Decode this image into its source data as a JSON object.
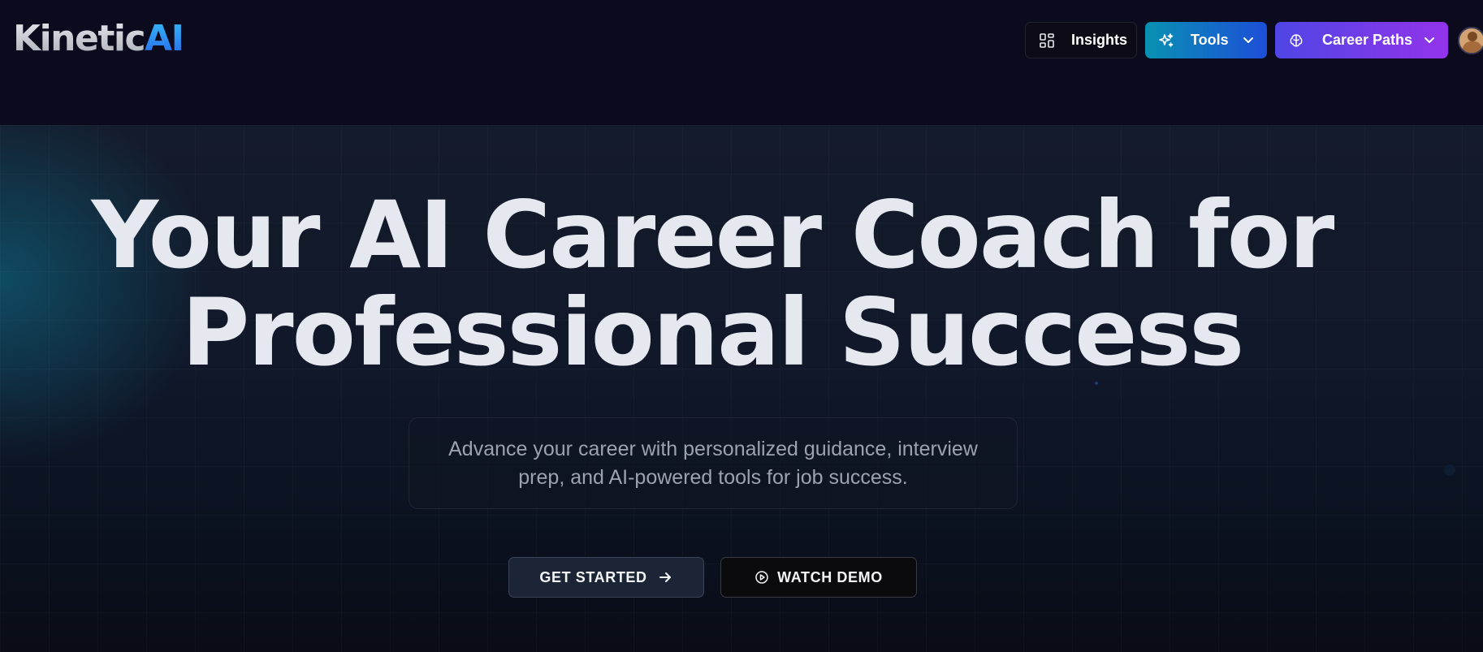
{
  "logo": {
    "text_base": "Kinetic",
    "text_accent": "AI"
  },
  "nav": {
    "insights": {
      "label": "Insights",
      "icon": "grid-icon"
    },
    "tools": {
      "label": "Tools",
      "icon": "sparkles-icon",
      "chevron": "chevron-down-icon"
    },
    "career_paths": {
      "label": "Career Paths",
      "icon": "brain-icon",
      "chevron": "chevron-down-icon"
    },
    "avatar": {
      "icon": "user-avatar"
    }
  },
  "hero": {
    "headline_line1": "Your AI Career Coach for",
    "headline_line2": "Professional Success",
    "subtitle": "Advance your career with personalized guidance, interview prep, and AI-powered tools for job success.",
    "get_started_label": "GET STARTED",
    "watch_demo_label": "WATCH DEMO"
  },
  "colors": {
    "background": "#0b0b18",
    "logo_accent": "#2563eb",
    "tools_gradient": [
      "#0891b2",
      "#1d4ed8"
    ],
    "career_gradient": [
      "#4f46e5",
      "#9333ea"
    ]
  }
}
